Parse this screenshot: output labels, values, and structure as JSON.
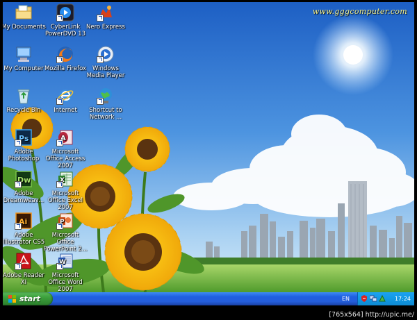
{
  "watermark": "www.gggcomputer.com",
  "credit": "[765x564] http://upic.me/",
  "desktop_icons": [
    {
      "label": "My Documents",
      "icon": "folder-documents-icon"
    },
    {
      "label": "CyberLink PowerDVD 13",
      "icon": "powerdvd-icon"
    },
    {
      "label": "Nero Express",
      "icon": "nero-icon"
    },
    {
      "label": "My Computer",
      "icon": "computer-icon"
    },
    {
      "label": "Mozilla Firefox",
      "icon": "firefox-icon"
    },
    {
      "label": "Windows Media Player",
      "icon": "media-player-icon"
    },
    {
      "label": "Recycle Bin",
      "icon": "recycle-bin-icon"
    },
    {
      "label": "Internet",
      "icon": "internet-explorer-icon"
    },
    {
      "label": "Shortcut to Network ...",
      "icon": "network-icon"
    },
    {
      "label": "Adobe Photoshop",
      "icon": "photoshop-icon"
    },
    {
      "label": "Microsoft Office Access 2007",
      "icon": "access-icon"
    },
    {
      "label": "Adobe Dreamweav...",
      "icon": "dreamweaver-icon"
    },
    {
      "label": "Microsoft Office Excel 2007",
      "icon": "excel-icon"
    },
    {
      "label": "Adobe Illustrator CS5",
      "icon": "illustrator-icon"
    },
    {
      "label": "Microsoft Office PowerPoint 2...",
      "icon": "powerpoint-icon"
    },
    {
      "label": "Adobe Reader XI",
      "icon": "acrobat-reader-icon"
    },
    {
      "label": "Microsoft Office Word 2007",
      "icon": "word-icon"
    }
  ],
  "taskbar": {
    "start_label": "start",
    "language": "EN",
    "clock": "17:24"
  },
  "colors": {
    "sky_top": "#1d5fc4",
    "taskbar": "#245edb",
    "start_button": "#3c9f3c",
    "tray": "#129be6"
  }
}
